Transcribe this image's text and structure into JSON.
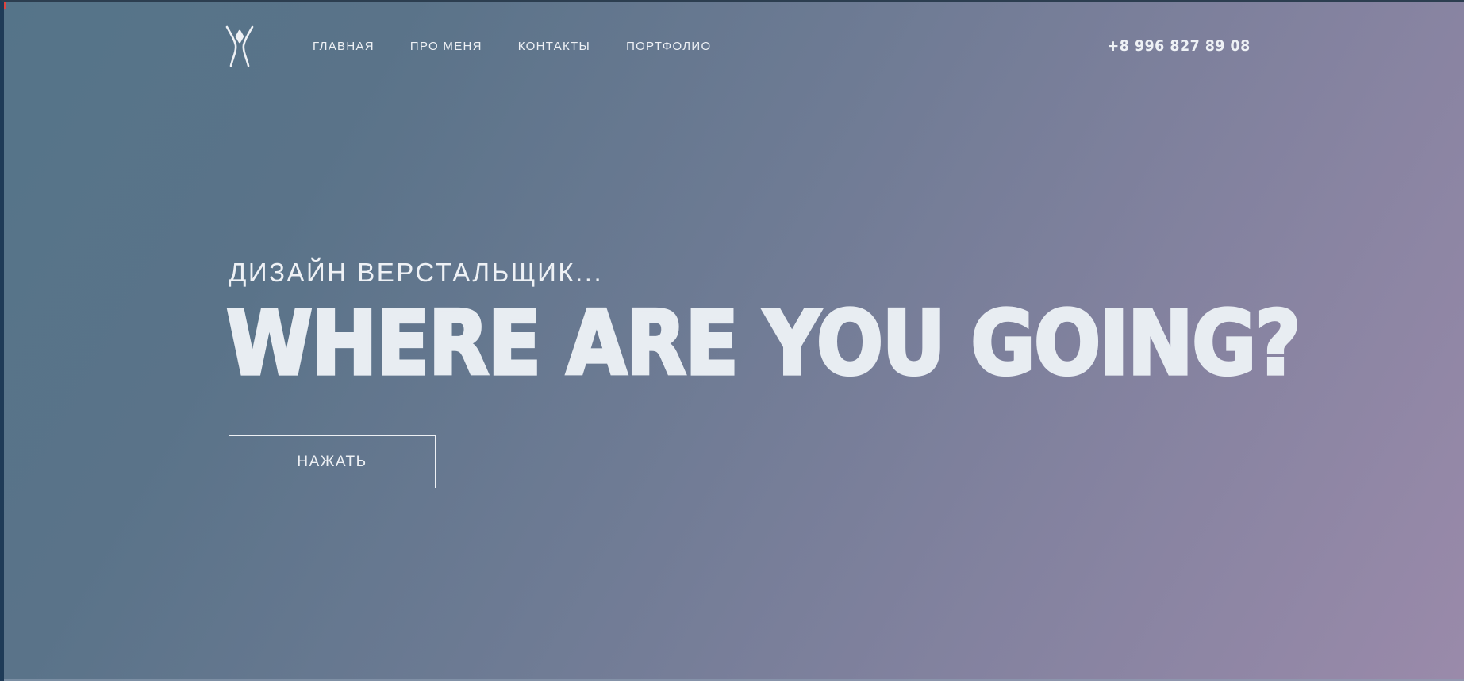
{
  "header": {
    "logo": {
      "icon": "person-figure-logo-icon"
    },
    "nav": [
      {
        "label": "ГЛАВНАЯ"
      },
      {
        "label": "ПРО МЕНЯ"
      },
      {
        "label": "КОНТАКТЫ"
      },
      {
        "label": "ПОРТФОЛИО"
      }
    ],
    "phone": "+8 996 827 89 08"
  },
  "hero": {
    "subtitle": "ДИЗАЙН ВЕРСТАЛЬЩИК...",
    "headline": "WHERE ARE YOU GOING?",
    "cta_label": "НАЖАТЬ"
  },
  "colors": {
    "gradient_start": "#557489",
    "gradient_end": "#9a8aaa",
    "text": "#eef1f5"
  }
}
